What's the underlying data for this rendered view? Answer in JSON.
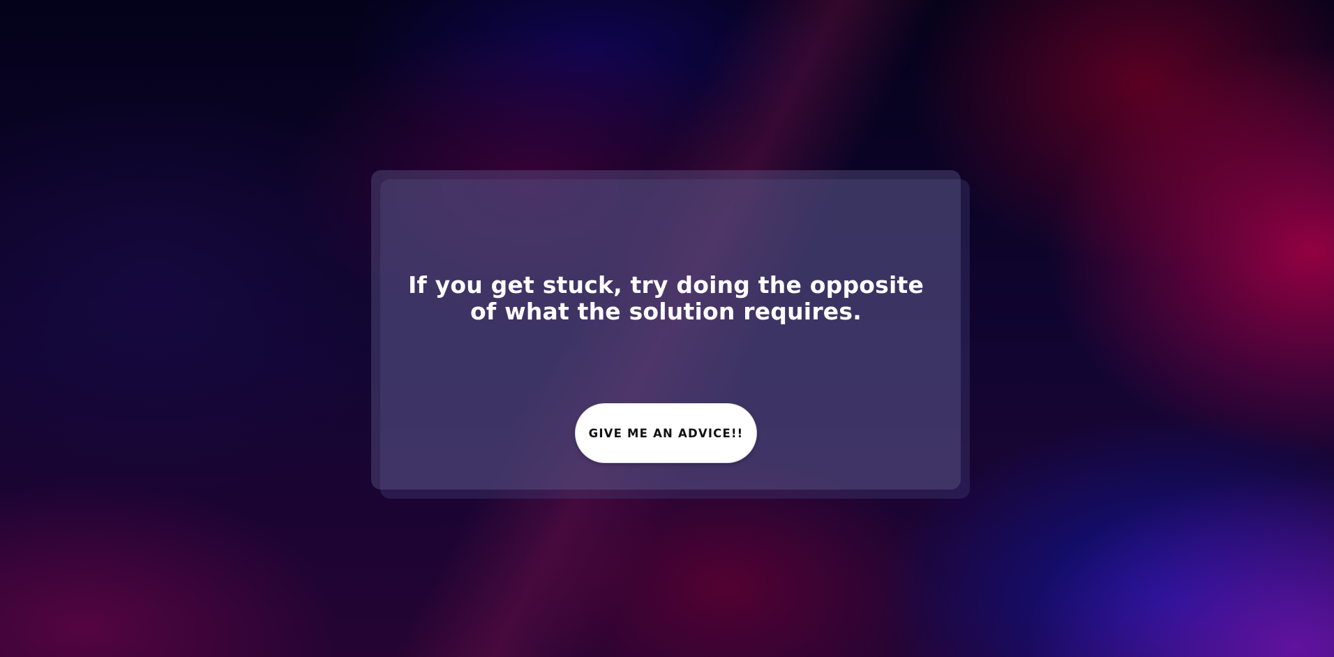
{
  "advice": {
    "text": "If you get stuck, try doing the opposite of what the solution requires."
  },
  "button": {
    "label": "GIVE ME AN ADVICE!!"
  },
  "colors": {
    "card_background": "#625c8c",
    "text": "#ffffff",
    "button_background": "#ffffff",
    "button_text": "#111111",
    "background_dark": "#06041f",
    "background_accent_red": "#aa0046",
    "background_accent_blue": "#0a1496"
  }
}
